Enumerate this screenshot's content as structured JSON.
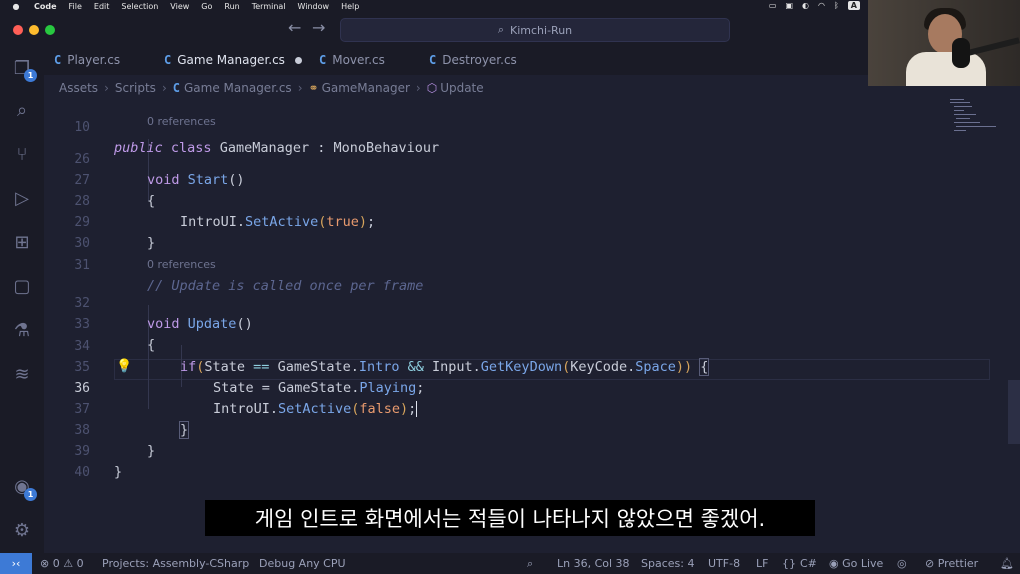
{
  "menubar": {
    "app": "Code",
    "items": [
      "File",
      "Edit",
      "Selection",
      "View",
      "Go",
      "Run",
      "Terminal",
      "Window",
      "Help"
    ],
    "input_badge": "A"
  },
  "titlebar": {
    "search": "Kimchi-Run"
  },
  "tabs": [
    {
      "label": "Player.cs",
      "icon": "C"
    },
    {
      "label": "Game Manager.cs",
      "icon": "C",
      "modified": true
    },
    {
      "label": "Mover.cs",
      "icon": "C"
    },
    {
      "label": "Destroyer.cs",
      "icon": "C"
    }
  ],
  "breadcrumb": [
    "Assets",
    "Scripts",
    "Game Manager.cs",
    "GameManager",
    "Update"
  ],
  "editor": {
    "refs_0": "0 references",
    "refs_1": "0 references",
    "lines": {
      "l10": "10",
      "l26": "26",
      "l27": "27",
      "l28": "28",
      "l29": "29",
      "l30": "30",
      "l31": "31",
      "l32": "32",
      "l33": "33",
      "l34": "34",
      "l35": "35",
      "l36": "36",
      "l37": "37",
      "l38": "38",
      "l39": "39",
      "l40": "40"
    },
    "tokens": {
      "public": "public",
      "class": "class",
      "GameManager": "GameManager",
      "colon": " : ",
      "MonoBehaviour": "MonoBehaviour",
      "void": "void",
      "Start": "Start",
      "Update": "Update",
      "parens": "()",
      "lbrace": "{",
      "rbrace": "}",
      "IntroUI": "IntroUI",
      "dot": ".",
      "SetActive": "SetActive",
      "lparen": "(",
      "rparen": ")",
      "semi": ";",
      "true": "true",
      "false": "false",
      "comment": "// Update is called once per frame",
      "if": "if",
      "State": "State",
      "eqeq": " == ",
      "GameState": "GameState",
      "Intro": "Intro",
      "and": " && ",
      "Input": "Input",
      "GetKeyDown": "GetKeyDown",
      "KeyCode": "KeyCode",
      "Space": "Space",
      "rparen2": ")) ",
      "assign": " = ",
      "Playing": "Playing"
    }
  },
  "caption": "게임 인트로 화면에서는 적들이 나타나지 않았으면 좋겠어.",
  "activity": {
    "explorer_badge": "1",
    "account_badge": "1"
  },
  "statusbar": {
    "errors": "0",
    "warnings": "0",
    "projects": "Projects: Assembly-CSharp",
    "debug": "Debug Any CPU",
    "position": "Ln 36, Col 38",
    "spaces": "Spaces: 4",
    "encoding": "UTF-8",
    "eol": "LF",
    "language": "C#",
    "golive": "Go Live",
    "prettier": "Prettier"
  },
  "colors": {
    "accent": "#3d7ad6",
    "keyword": "#bf9ae8",
    "function": "#7aa6e8",
    "boolean": "#e89a6e"
  }
}
